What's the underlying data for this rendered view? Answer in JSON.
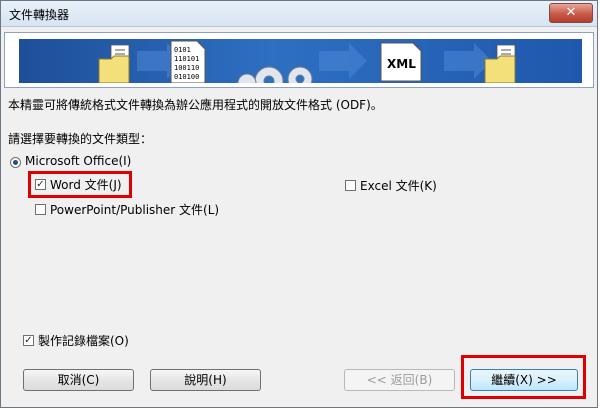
{
  "window": {
    "title": "文件轉換器",
    "close_symbol": "✕"
  },
  "banner": {
    "xml_label": "XML",
    "binary_lines": [
      "0101",
      "110101",
      "100110",
      "010100"
    ]
  },
  "description": "本精靈可將傳統格式文件轉換為辦公應用程式的開放文件格式 (ODF)。",
  "prompt": "請選擇要轉換的文件類型：",
  "options": {
    "microsoft_office": {
      "label": "Microsoft Office(I)",
      "selected": true
    },
    "word": {
      "label": "Word 文件(J)",
      "checked": true
    },
    "excel": {
      "label": "Excel 文件(K)",
      "checked": false
    },
    "powerpoint": {
      "label": "PowerPoint/Publisher 文件(L)",
      "checked": false
    },
    "logfile": {
      "label": "製作記錄檔案(O)",
      "checked": true
    }
  },
  "buttons": {
    "cancel": "取消(C)",
    "help": "說明(H)",
    "back": "<< 返回(B)",
    "next": "繼續(X) >>"
  },
  "highlight_color": "#e00000"
}
